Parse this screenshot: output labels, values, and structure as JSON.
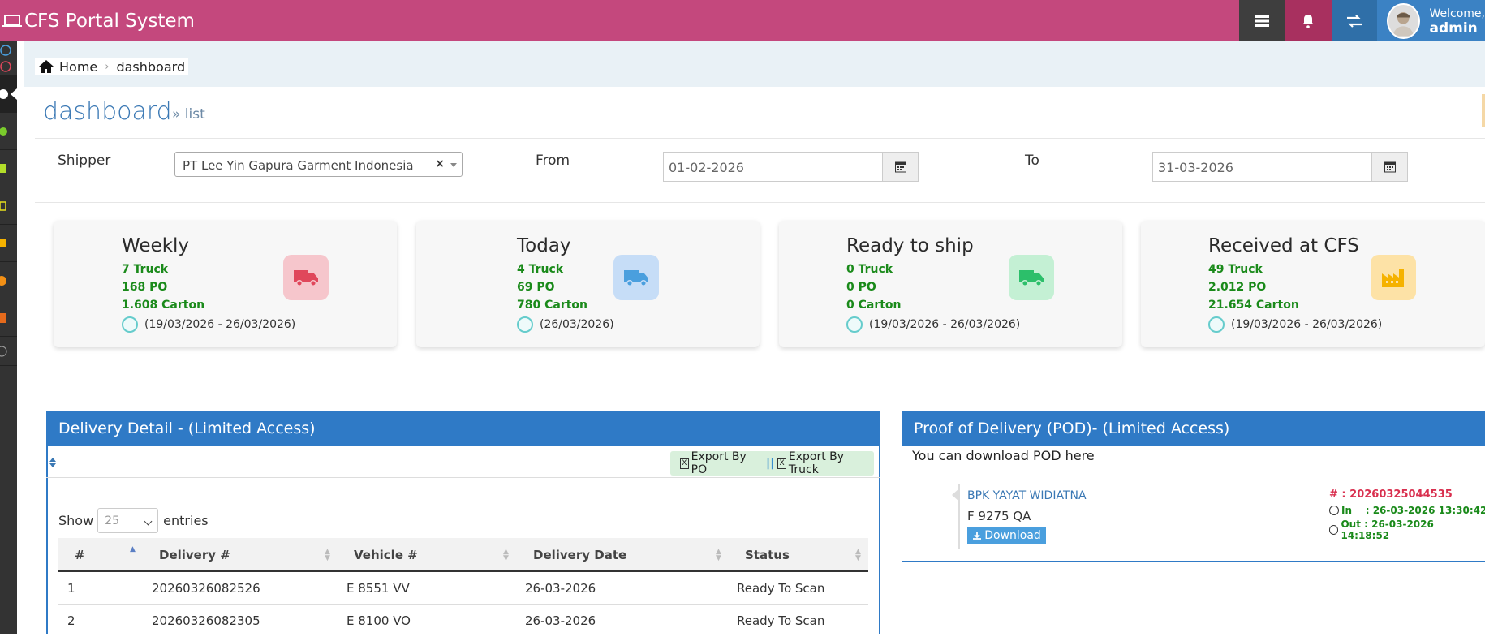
{
  "app": {
    "title": "CFS Portal System",
    "welcome": "Welcome,",
    "user": "admin"
  },
  "breadcrumb": {
    "home": "Home",
    "current": "dashboard"
  },
  "page": {
    "title": "dashboard",
    "subtitle": "» list"
  },
  "filters": {
    "shipper_label": "Shipper",
    "shipper_value": "PT Lee Yin Gapura Garment Indonesia",
    "clear": "×",
    "from_label": "From",
    "from_value": "01-02-2026",
    "to_label": "To",
    "to_value": "31-03-2026"
  },
  "cards": [
    {
      "title": "Weekly",
      "truck": "7 Truck",
      "po": "168 PO",
      "carton": "1.608 Carton",
      "range": "(19/03/2026 - 26/03/2026)",
      "icon": "truck-icon",
      "color": "#f6c6cc",
      "fg": "#e0475b"
    },
    {
      "title": "Today",
      "truck": "4 Truck",
      "po": "69 PO",
      "carton": "780 Carton",
      "range": "(26/03/2026)",
      "icon": "truck-icon",
      "color": "#c6ddf7",
      "fg": "#4a9fde"
    },
    {
      "title": "Ready to ship",
      "truck": "0 Truck",
      "po": "0 PO",
      "carton": "0 Carton",
      "range": "(19/03/2026 - 26/03/2026)",
      "icon": "truck-icon",
      "color": "#c4f0d4",
      "fg": "#2cbf6a"
    },
    {
      "title": "Received at CFS",
      "truck": "49 Truck",
      "po": "2.012 PO",
      "carton": "21.654 Carton",
      "range": "(19/03/2026 - 26/03/2026)",
      "icon": "factory-icon",
      "color": "#fde2a6",
      "fg": "#f5b200"
    }
  ],
  "delivery": {
    "title": "Delivery Detail - (Limited Access)",
    "export_po": "Export By PO",
    "export_truck": "Export By Truck",
    "sep": "||",
    "show": "Show",
    "entries_value": "25",
    "entries": "entries",
    "columns": [
      "#",
      "Delivery #",
      "Vehicle #",
      "Delivery Date",
      "Status"
    ],
    "rows": [
      [
        "1",
        "20260326082526",
        "E 8551 VV",
        "26-03-2026",
        "Ready To Scan"
      ],
      [
        "2",
        "20260326082305",
        "E 8100 VO",
        "26-03-2026",
        "Ready To Scan"
      ]
    ]
  },
  "pod": {
    "title": "Proof of Delivery (POD)- (Limited Access)",
    "intro": "You can download POD here",
    "name": "BPK YAYAT WIDIATNA",
    "vehicle": "F 9275 QA",
    "download": "Download",
    "number": "# : 20260325044535",
    "in": "In    : 26-03-2026 13:30:42",
    "out": "Out : 26-03-2026 14:18:52"
  }
}
